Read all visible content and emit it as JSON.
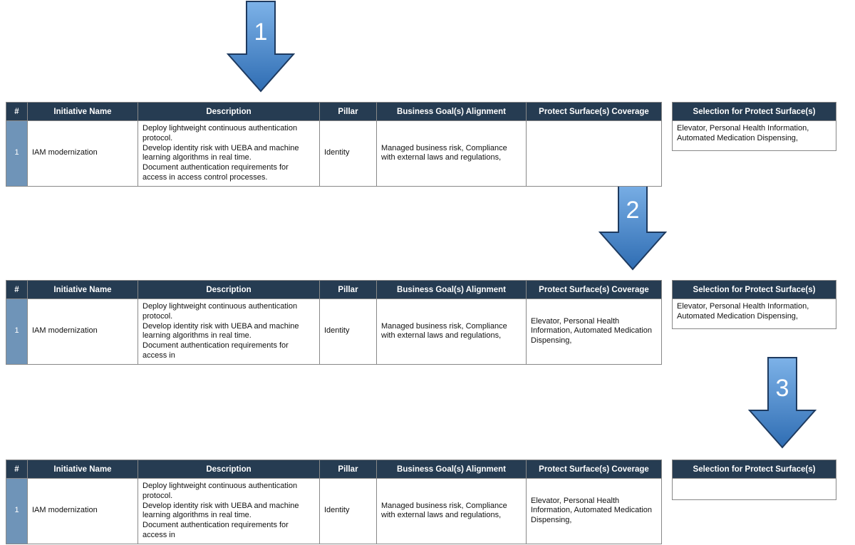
{
  "arrows": {
    "a1": "1",
    "a2": "2",
    "a3": "3"
  },
  "headers": {
    "num": "#",
    "name": "Initiative Name",
    "desc": "Description",
    "pillar": "Pillar",
    "goals": "Business Goal(s) Alignment",
    "protect": "Protect Surface(s) Coverage",
    "selection": "Selection for Protect Surface(s)"
  },
  "row": {
    "num": "1",
    "name": "IAM modernization",
    "desc_full": "Deploy lightweight continuous authentication protocol.\nDevelop identity risk with UEBA and machine learning algorithms in real time.\nDocument authentication requirements for access in access control processes.",
    "desc_trunc": "Deploy lightweight continuous authentication protocol.\nDevelop identity risk with UEBA and machine learning algorithms in real time.\nDocument authentication requirements for access in",
    "pillar": "Identity",
    "goals": "Managed business risk, Compliance with external laws and regulations,",
    "protect_filled": "Elevator, Personal Health Information, Automated Medication Dispensing,",
    "protect_empty": ""
  },
  "selection": {
    "filled": "Elevator, Personal Health Information, Automated Medication Dispensing,",
    "empty": ""
  }
}
